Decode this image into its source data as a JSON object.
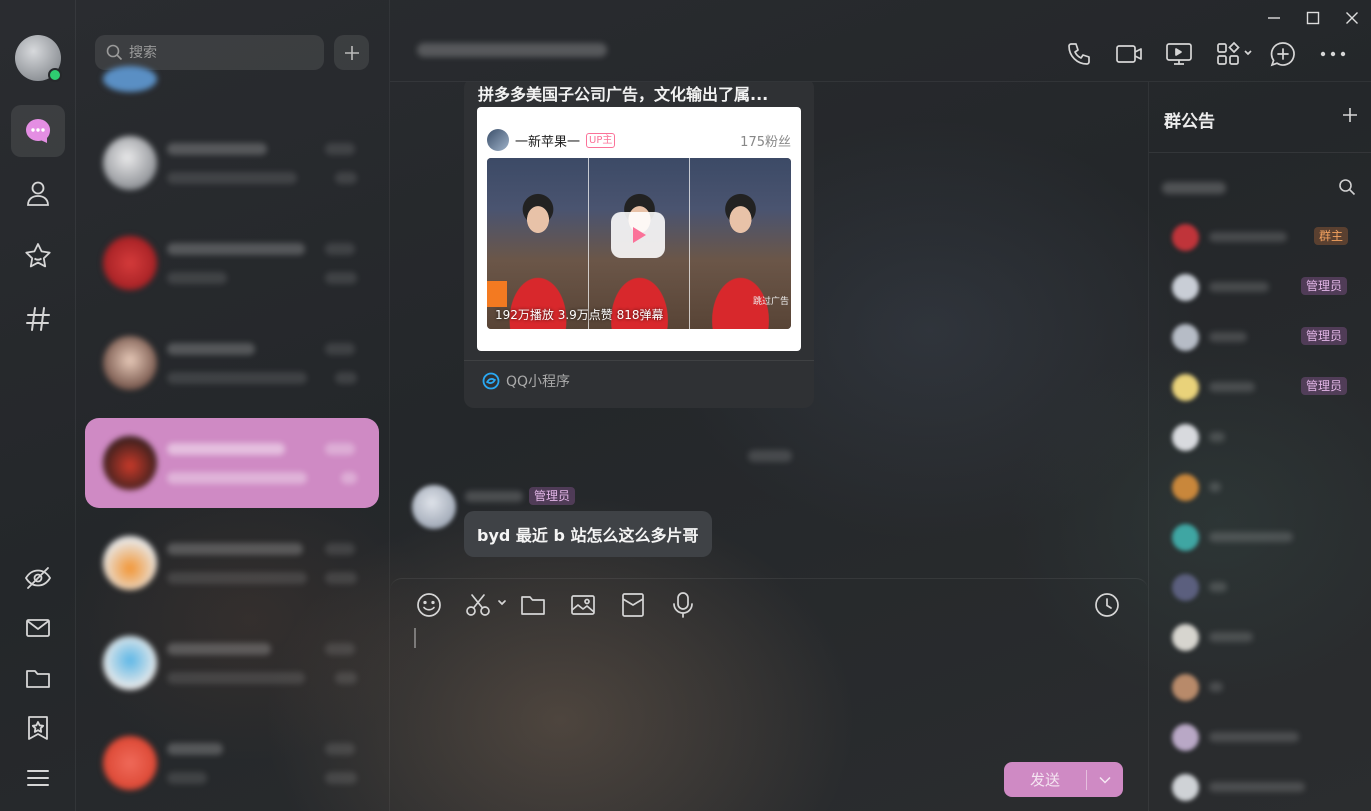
{
  "search": {
    "placeholder": "搜索"
  },
  "chat": {
    "shared_card": {
      "title": "拼多多美国子公司广告，文化输出了属...",
      "uploader": "一新苹果一",
      "uploader_tag": "UP主",
      "followers": "175粉丝",
      "stats": "192万播放  3.9万点赞  818弹幕",
      "skip_ad": "跳过广告",
      "source": "QQ小程序"
    },
    "message": {
      "role": "管理员",
      "text": "byd 最近 b 站怎么这么多片哥"
    }
  },
  "composer": {
    "send_label": "发送"
  },
  "right_panel": {
    "title": "群公告",
    "members": [
      {
        "role": "群主",
        "color": "#c0343a"
      },
      {
        "role": "管理员",
        "color": "#c9ced6"
      },
      {
        "role": "管理员",
        "color": "#b6bcc6"
      },
      {
        "role": "管理员",
        "color": "#e9d27a"
      },
      {
        "role": "",
        "color": "#d8dade"
      },
      {
        "role": "",
        "color": "#c9873b"
      },
      {
        "role": "",
        "color": "#3fa6a3"
      },
      {
        "role": "",
        "color": "#5b5f7e"
      },
      {
        "role": "",
        "color": "#d7d5cf"
      },
      {
        "role": "",
        "color": "#b88a6a"
      },
      {
        "role": "",
        "color": "#b9a8c6"
      },
      {
        "role": "",
        "color": "#cfd2d6"
      }
    ]
  },
  "colors": {
    "accent": "#cf8ac4",
    "online": "#2ecc71"
  }
}
